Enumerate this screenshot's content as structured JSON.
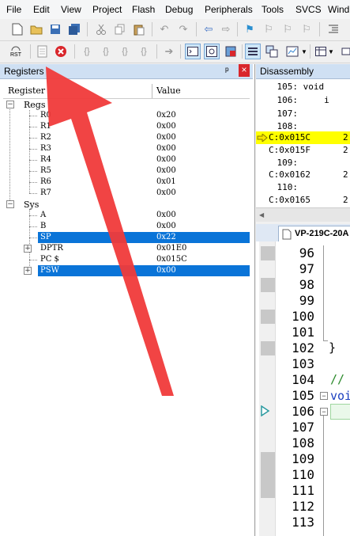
{
  "menu": [
    "File",
    "Edit",
    "View",
    "Project",
    "Flash",
    "Debug",
    "Peripherals",
    "Tools",
    "SVCS",
    "Wind"
  ],
  "toolbar1": [
    "new-file-icon",
    "open-folder-icon",
    "save-icon",
    "save-all-icon",
    "cut-icon",
    "copy-icon",
    "paste-icon",
    "undo-icon",
    "redo-icon",
    "back-icon",
    "forward-icon",
    "bookmark-icon",
    "bookmark-prev-icon",
    "bookmark-next-icon",
    "bookmark-clear-icon",
    "indent-icon"
  ],
  "toolbar2": {
    "rst": "RST",
    "icons": [
      "reset-icon",
      "run-icon",
      "stop-icon",
      "step-into-icon",
      "step-over-icon",
      "step-out-icon",
      "run-to-cursor-icon",
      "show-next-statement-icon",
      "command-window-icon",
      "disassembly-window-icon",
      "symbols-window-icon",
      "registers-window-icon",
      "call-stack-icon",
      "watch-window-icon",
      "memory-window-icon"
    ]
  },
  "registers": {
    "title": "Registers",
    "pin": "ᵖ",
    "close": "×",
    "col_register": "Register",
    "col_value": "Value",
    "groups": {
      "regs": "Regs",
      "sys": "Sys"
    },
    "regs": [
      {
        "name": "R0",
        "value": "0x20"
      },
      {
        "name": "R1",
        "value": "0x00"
      },
      {
        "name": "R2",
        "value": "0x00"
      },
      {
        "name": "R3",
        "value": "0x00"
      },
      {
        "name": "R4",
        "value": "0x00"
      },
      {
        "name": "R5",
        "value": "0x00"
      },
      {
        "name": "R6",
        "value": "0x01"
      },
      {
        "name": "R7",
        "value": "0x00"
      }
    ],
    "sys": [
      {
        "name": "A",
        "value": "0x00"
      },
      {
        "name": "B",
        "value": "0x00"
      },
      {
        "name": "SP",
        "value": "0x22"
      },
      {
        "name": "DPTR",
        "value": "0x01E0"
      },
      {
        "name": "PC $",
        "value": "0x015C"
      },
      {
        "name": "PSW",
        "value": "0x00"
      }
    ]
  },
  "disassembly": {
    "title": "Disassembly",
    "lines": [
      {
        "left": "    105: void ",
        "right": ""
      },
      {
        "left": "    106:     i",
        "right": ""
      },
      {
        "left": "    107:",
        "right": ""
      },
      {
        "left": "    108:",
        "right": ""
      },
      {
        "left": "C:0x015C",
        "right": "2"
      },
      {
        "left": "C:0x015F",
        "right": "2"
      },
      {
        "left": "    109:",
        "right": ""
      },
      {
        "left": "C:0x0162",
        "right": "2"
      },
      {
        "left": "    110:",
        "right": ""
      },
      {
        "left": "C:0x0165",
        "right": "2"
      }
    ]
  },
  "editor": {
    "tab_label": "VP-219C-20A",
    "line_numbers": [
      "96",
      "97",
      "98",
      "99",
      "100",
      "101",
      "102",
      "103",
      "104",
      "105",
      "106",
      "107",
      "108",
      "109",
      "110",
      "111",
      "112",
      "113"
    ],
    "code": {
      "brace_close": "}",
      "comment": "//",
      "void_kw": "voi"
    }
  },
  "colors": {
    "selection": "#0a74d8",
    "current_line": "#ffff00",
    "annotation_arrow": "#f03a3a"
  }
}
